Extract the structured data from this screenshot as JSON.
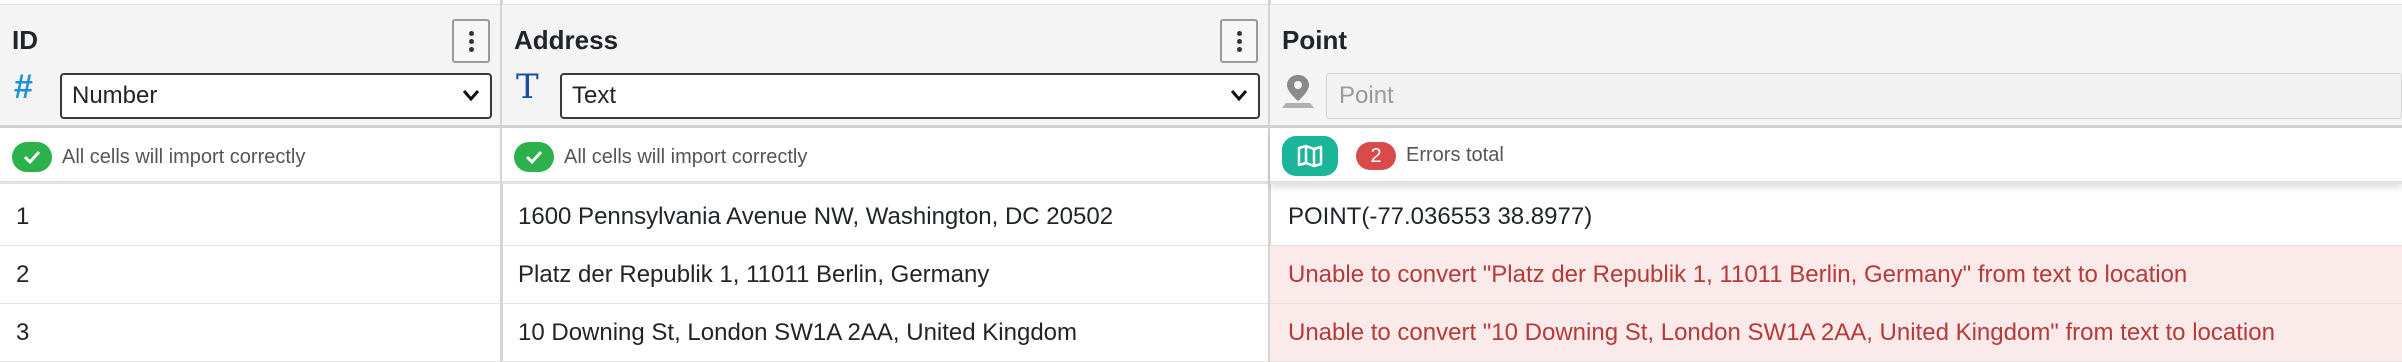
{
  "columns": [
    {
      "title": "ID",
      "type_icon": "hash-icon",
      "type_select": "Number",
      "status_text": "All cells will import correctly",
      "rows": [
        "1",
        "2",
        "3"
      ]
    },
    {
      "title": "Address",
      "type_icon": "text-type-icon",
      "type_select": "Text",
      "status_text": "All cells will import correctly",
      "rows": [
        "1600 Pennsylvania Avenue NW, Washington, DC 20502",
        "Platz der Republik 1, 11011 Berlin, Germany",
        "10 Downing St, London SW1A 2AA, United Kingdom"
      ]
    },
    {
      "title": "Point",
      "type_icon": "map-pin-icon",
      "type_placeholder": "Point",
      "error_count": "2",
      "error_label": "Errors total",
      "rows": [
        "POINT(-77.036553 38.8977)",
        "Unable to convert \"Platz der Republik 1, 11011 Berlin, Germany\" from text to location",
        "Unable to convert \"10 Downing St, London SW1A 2AA, United Kingdom\" from text to location"
      ]
    }
  ],
  "colors": {
    "success": "#2cb24d",
    "error_badge": "#d94b4b",
    "error_row_bg": "#fbeaea",
    "error_text": "#b53a3a",
    "map_button": "#1bb59a",
    "number_icon": "#1f8fd6",
    "text_icon": "#1c4ea0"
  }
}
